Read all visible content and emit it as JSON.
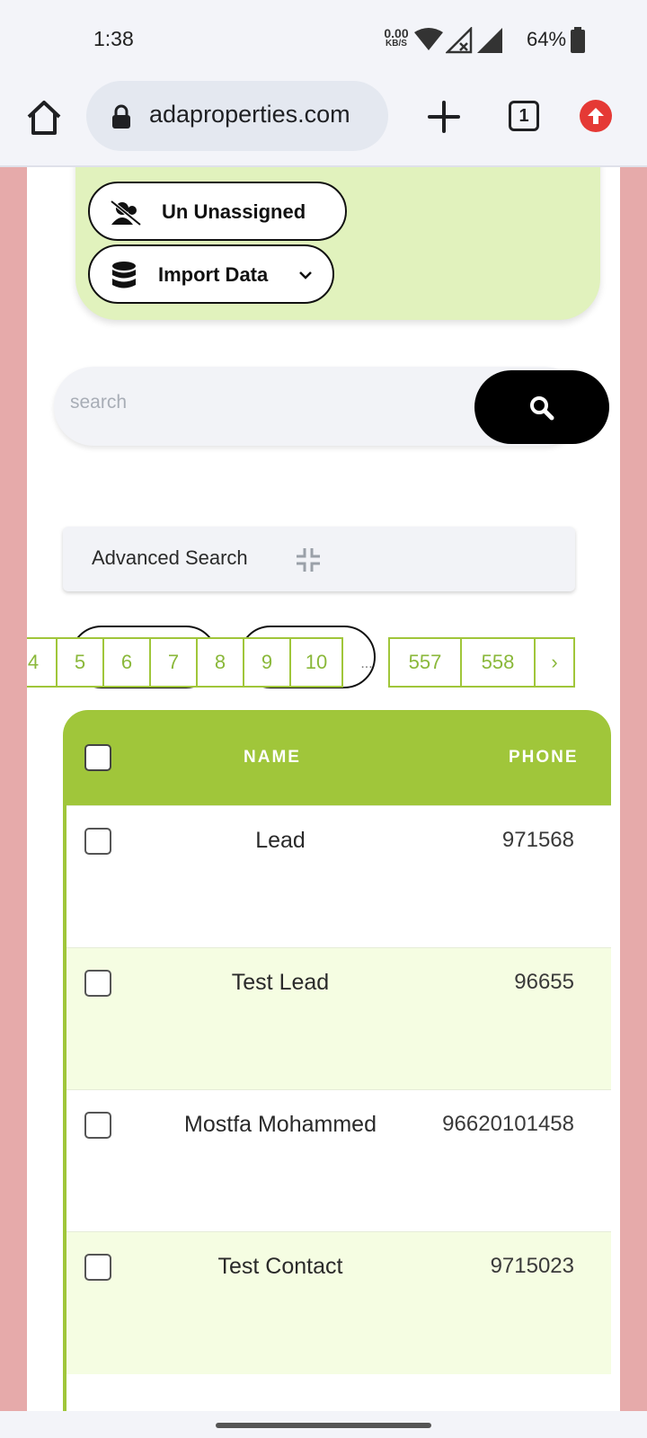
{
  "status_bar": {
    "time": "1:38",
    "net_speed_value": "0.00",
    "net_speed_unit": "KB/S",
    "battery": "64%",
    "icons": [
      "wifi-icon",
      "signal-off-icon",
      "signal-icon",
      "battery-icon"
    ]
  },
  "browser": {
    "url": "adaproperties.com",
    "tab_count": "1",
    "icons": [
      "home-icon",
      "lock-icon",
      "plus-icon",
      "tabs-icon",
      "update-icon"
    ]
  },
  "actions": {
    "unassigned_label": "Un Unassigned",
    "import_label": "Import Data",
    "icons": [
      "user-slash-icon",
      "database-icon",
      "chevron-down-icon"
    ]
  },
  "search": {
    "placeholder": "search",
    "icon": "search-icon"
  },
  "advanced_search": {
    "label": "Advanced Search",
    "icon": "compress-icon"
  },
  "pagination": {
    "pages": [
      "4",
      "5",
      "6",
      "7",
      "8",
      "9",
      "10",
      "...",
      "557",
      "558",
      "›"
    ]
  },
  "table": {
    "columns": [
      "NAME",
      "PHONE"
    ],
    "rows": [
      {
        "name": "Lead",
        "phone": "971568"
      },
      {
        "name": "Test Lead",
        "phone": "96655"
      },
      {
        "name": "Mostfa Mohammed",
        "phone": "96620101458"
      },
      {
        "name": "Test Contact",
        "phone": "9715023"
      }
    ]
  },
  "colors": {
    "accent_green": "#a0c63a",
    "light_green": "#e1f2bd",
    "row_alt": "#f5fde2",
    "side_pink": "#e6aaaa",
    "browser_update": "#e53935"
  }
}
